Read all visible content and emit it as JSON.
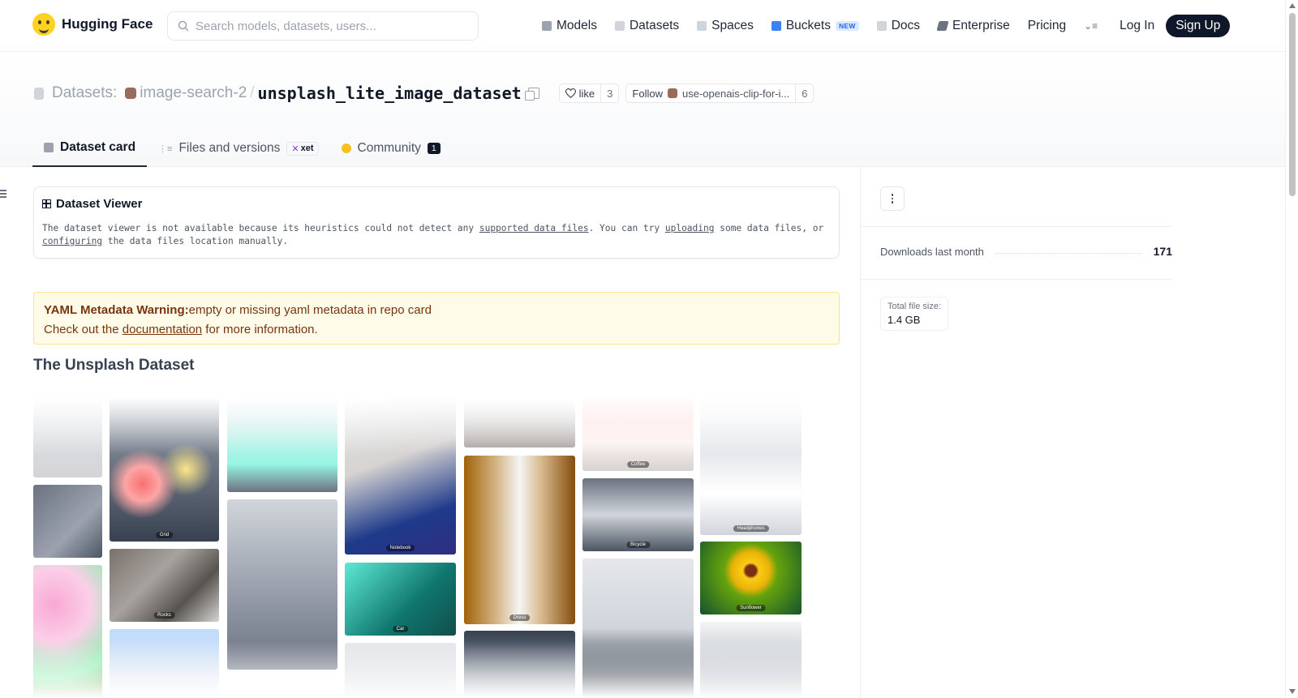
{
  "brand": {
    "name": "Hugging Face"
  },
  "search": {
    "placeholder": "Search models, datasets, users..."
  },
  "nav": {
    "models": "Models",
    "datasets": "Datasets",
    "spaces": "Spaces",
    "buckets": "Buckets",
    "buckets_badge": "NEW",
    "docs": "Docs",
    "enterprise": "Enterprise",
    "pricing": "Pricing",
    "login": "Log In",
    "signup": "Sign Up"
  },
  "repo": {
    "prefix": "Datasets:",
    "org": "image-search-2",
    "separator": "/",
    "name": "unsplash_lite_image_dataset",
    "like_label": "like",
    "like_count": "3",
    "follow_label": "Follow",
    "follow_org": "use-openais-clip-for-i...",
    "follow_count": "6"
  },
  "tabs": {
    "card": "Dataset card",
    "files": "Files and versions",
    "xet": "xet",
    "community": "Community",
    "community_count": "1"
  },
  "viewer": {
    "title": "Dataset Viewer",
    "text1": "The dataset viewer is not available because its heuristics could not detect any ",
    "link1": "supported data files",
    "text2": ". You can try ",
    "link2": "uploading",
    "text3": " some data files, or ",
    "link3": "configuring",
    "text4": " the data files location manually."
  },
  "warning": {
    "bold": "YAML Metadata Warning:",
    "message": "empty or missing yaml metadata in repo card",
    "line2_a": "Check out the ",
    "link": "documentation",
    "line2_b": " for more information."
  },
  "section": {
    "title": "The Unsplash Dataset"
  },
  "mosaic": {
    "captions": [
      "Grid",
      "Rocks",
      "Notebook",
      "Car",
      "Dress",
      "Coffee",
      "Bicycle",
      "Headphones",
      "Sunflower"
    ]
  },
  "sidebar": {
    "downloads_label": "Downloads last month",
    "downloads_value": "171",
    "filesize_label": "Total file size:",
    "filesize_value": "1.4 GB"
  },
  "colors": {
    "signup_bg": "#0f172a",
    "warning_bg": "#fefce8",
    "accent_purple": "#9333ea"
  }
}
